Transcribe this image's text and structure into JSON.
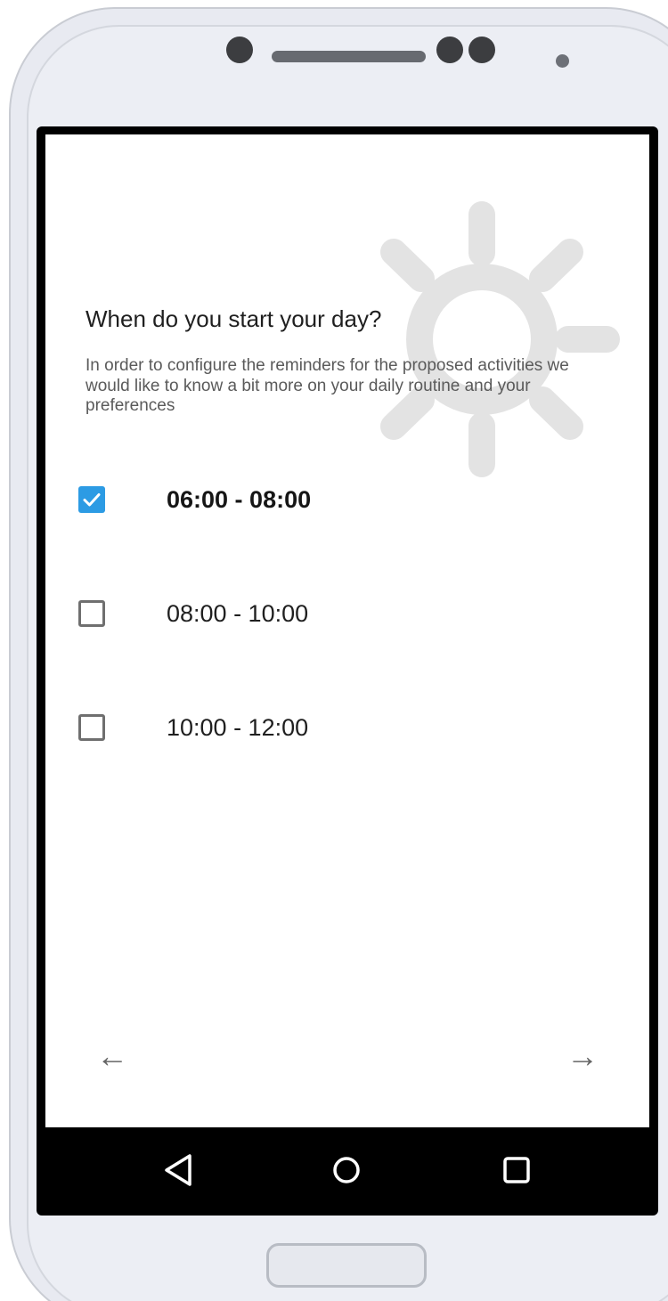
{
  "question": {
    "title": "When do you start your day?",
    "subtitle": "In order to configure the reminders for the proposed activities we would like to know a bit more on your daily routine and your preferences"
  },
  "options": [
    {
      "label": "06:00 - 08:00",
      "checked": true
    },
    {
      "label": "08:00 - 10:00",
      "checked": false
    },
    {
      "label": "10:00 - 12:00",
      "checked": false
    }
  ],
  "navigation": {
    "back_glyph": "←",
    "next_glyph": "→"
  },
  "icons": {
    "watermark": "sun-icon",
    "back": "arrow-left-icon",
    "next": "arrow-right-icon",
    "system_back": "triangle-back-icon",
    "system_home": "circle-home-icon",
    "system_recent": "square-recents-icon"
  },
  "colors": {
    "accent": "#2c9be4",
    "watermark": "#e3e3e3",
    "device_frame": "#e8eaf1",
    "system_bar": "#000000"
  }
}
